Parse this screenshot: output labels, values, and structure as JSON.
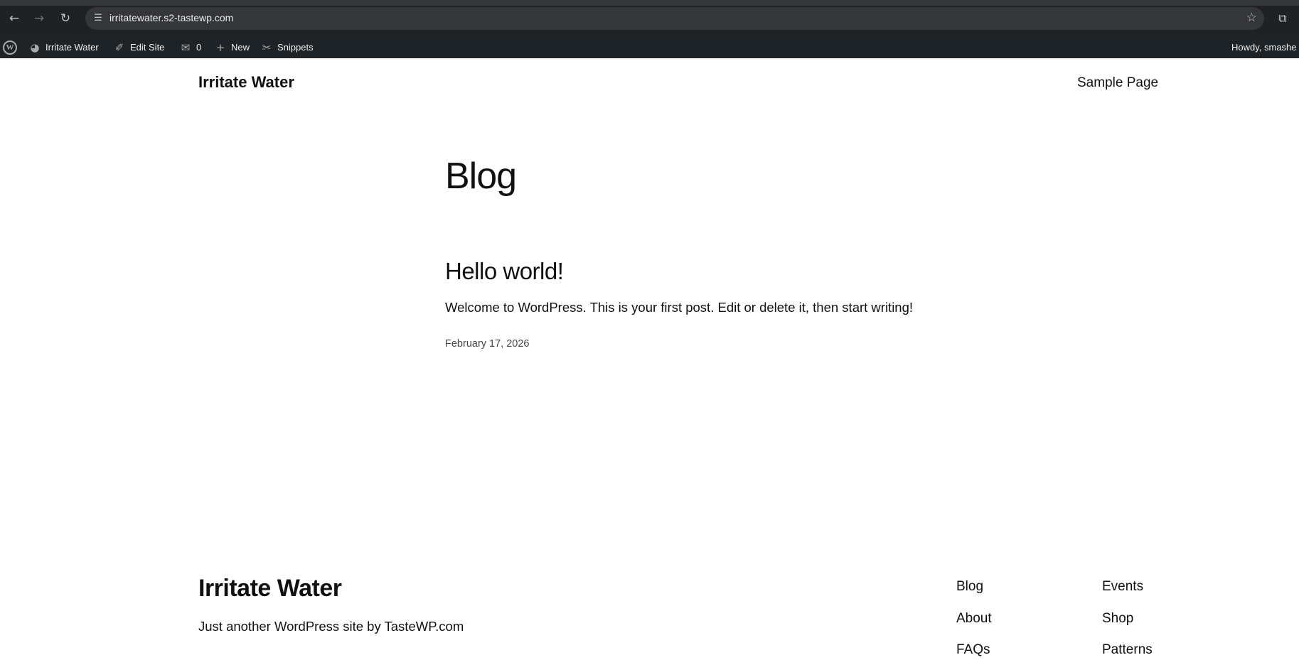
{
  "browser": {
    "url": "irritatewater.s2-tastewp.com",
    "back_icon": "arrow-left-icon",
    "forward_icon": "arrow-right-icon",
    "reload_icon": "reload-icon",
    "site_info_icon": "tune-icon",
    "bookmark_icon": "star-icon",
    "extensions_icon": "puzzle-icon"
  },
  "admin_bar": {
    "site_name": "Irritate Water",
    "edit_site": "Edit Site",
    "comments_count": "0",
    "new_label": "New",
    "snippets_label": "Snippets",
    "howdy": "Howdy, smashe"
  },
  "header": {
    "site_title": "Irritate Water",
    "nav": [
      "Sample Page"
    ]
  },
  "main": {
    "heading": "Blog",
    "posts": [
      {
        "title": "Hello world!",
        "excerpt": "Welcome to WordPress. This is your first post. Edit or delete it, then start writing!",
        "date": "February 17, 2026"
      }
    ]
  },
  "footer": {
    "site_title": "Irritate Water",
    "tagline": "Just another WordPress site by TasteWP.com",
    "col1": [
      "Blog",
      "About",
      "FAQs"
    ],
    "col2": [
      "Events",
      "Shop",
      "Patterns"
    ]
  }
}
